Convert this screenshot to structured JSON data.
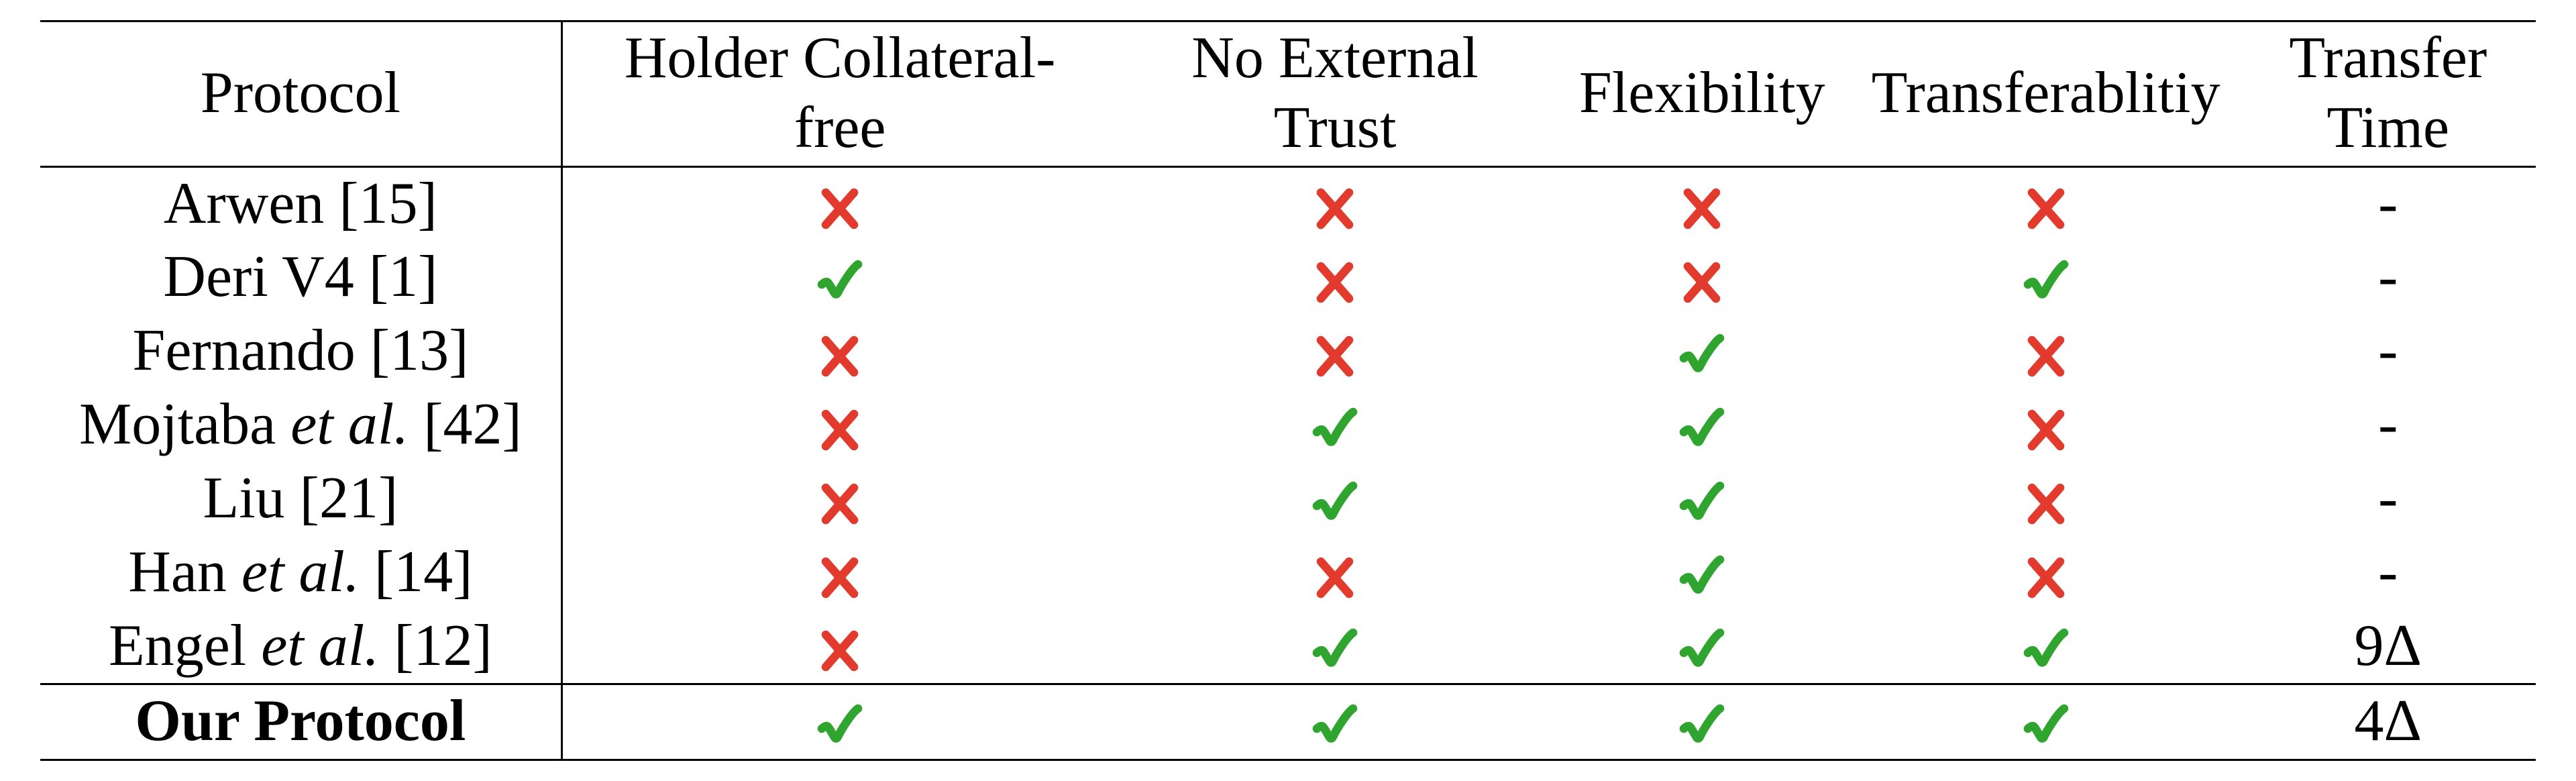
{
  "headers": {
    "protocol": "Protocol",
    "holder_collateral_free": "Holder Collateral-free",
    "no_external_trust": "No External Trust",
    "flexibility": "Flexibility",
    "transferability": "Transferablitiy",
    "transfer_time": "Transfer Time"
  },
  "rows": [
    {
      "protocol_pre": "Arwen ",
      "protocol_italic": "",
      "protocol_post": "",
      "ref": "[15]",
      "hcf": "cross",
      "net": "cross",
      "flex": "cross",
      "trans": "cross",
      "time": "-",
      "bold": false
    },
    {
      "protocol_pre": "Deri V4 ",
      "protocol_italic": "",
      "protocol_post": "",
      "ref": "[1]",
      "hcf": "check",
      "net": "cross",
      "flex": "cross",
      "trans": "check",
      "time": "-",
      "bold": false
    },
    {
      "protocol_pre": "Fernando ",
      "protocol_italic": "",
      "protocol_post": "",
      "ref": "[13]",
      "hcf": "cross",
      "net": "cross",
      "flex": "check",
      "trans": "cross",
      "time": "-",
      "bold": false
    },
    {
      "protocol_pre": "Mojtaba ",
      "protocol_italic": "et al.",
      "protocol_post": " ",
      "ref": "[42]",
      "hcf": "cross",
      "net": "check",
      "flex": "check",
      "trans": "cross",
      "time": "-",
      "bold": false
    },
    {
      "protocol_pre": "Liu ",
      "protocol_italic": "",
      "protocol_post": "",
      "ref": "[21]",
      "hcf": "cross",
      "net": "check",
      "flex": "check",
      "trans": "cross",
      "time": "-",
      "bold": false
    },
    {
      "protocol_pre": "Han ",
      "protocol_italic": "et al.",
      "protocol_post": " ",
      "ref": "[14]",
      "hcf": "cross",
      "net": "cross",
      "flex": "check",
      "trans": "cross",
      "time": "-",
      "bold": false
    },
    {
      "protocol_pre": "Engel ",
      "protocol_italic": "et al.",
      "protocol_post": " ",
      "ref": "[12]",
      "hcf": "cross",
      "net": "check",
      "flex": "check",
      "trans": "check",
      "time": "9Δ",
      "bold": false
    },
    {
      "protocol_pre": "Our Protocol",
      "protocol_italic": "",
      "protocol_post": "",
      "ref": "",
      "hcf": "check",
      "net": "check",
      "flex": "check",
      "trans": "check",
      "time": "4Δ",
      "bold": true
    }
  ],
  "marks": {
    "check_color": "#2fa52f",
    "cross_color": "#e23b2e"
  },
  "chart_data": {
    "type": "table",
    "title": "",
    "columns": [
      "Protocol",
      "Holder Collateral-free",
      "No External Trust",
      "Flexibility",
      "Transferablitiy",
      "Transfer Time"
    ],
    "rows": [
      [
        "Arwen [15]",
        false,
        false,
        false,
        false,
        "-"
      ],
      [
        "Deri V4 [1]",
        true,
        false,
        false,
        true,
        "-"
      ],
      [
        "Fernando [13]",
        false,
        false,
        true,
        false,
        "-"
      ],
      [
        "Mojtaba et al. [42]",
        false,
        true,
        true,
        false,
        "-"
      ],
      [
        "Liu [21]",
        false,
        true,
        true,
        false,
        "-"
      ],
      [
        "Han et al. [14]",
        false,
        false,
        true,
        false,
        "-"
      ],
      [
        "Engel et al. [12]",
        false,
        true,
        true,
        true,
        "9Δ"
      ],
      [
        "Our Protocol",
        true,
        true,
        true,
        true,
        "4Δ"
      ]
    ]
  }
}
